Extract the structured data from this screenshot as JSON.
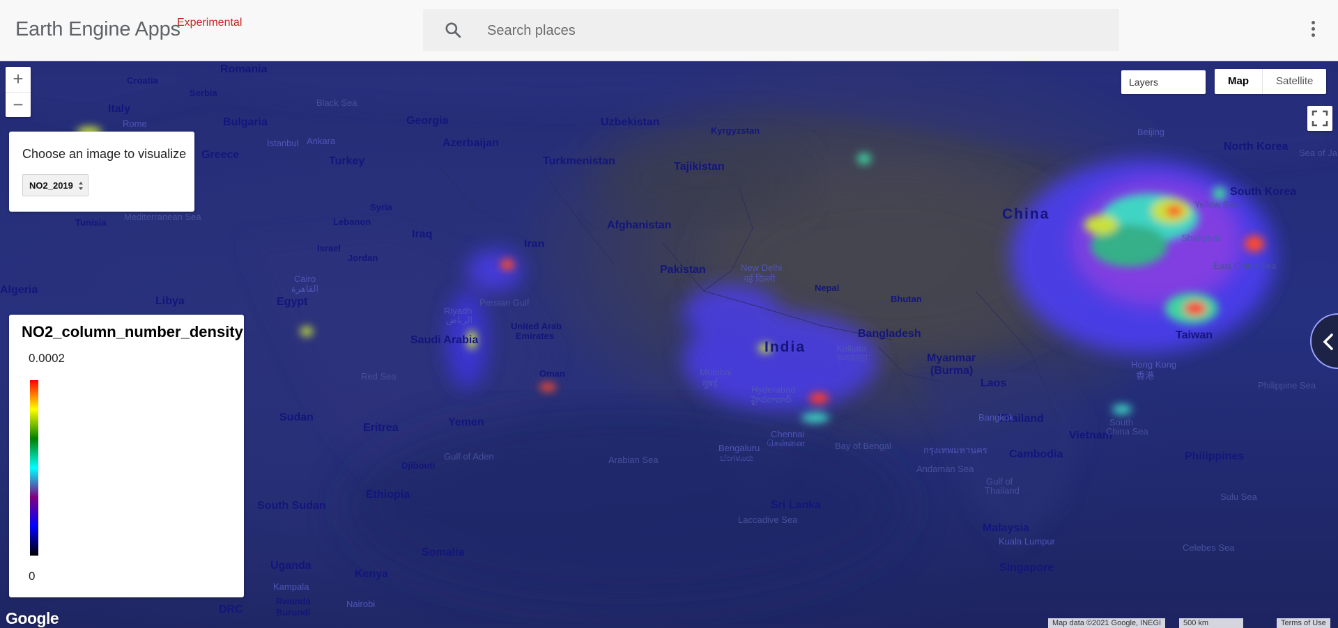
{
  "header": {
    "brand": "Earth Engine Apps",
    "brand_tag": "Experimental",
    "search_placeholder": "Search places"
  },
  "map_controls": {
    "zoom_in": "+",
    "zoom_out": "−",
    "layers_label": "Layers",
    "map_type": [
      "Map",
      "Satellite"
    ],
    "map_type_selected": "Map"
  },
  "panel": {
    "choose_label": "Choose an image to visualize",
    "selected_image": "NO2_2019"
  },
  "legend": {
    "title": "NO2_column_number_density",
    "max": "0.0002",
    "min": "0",
    "palette": [
      "#000000",
      "#0000ff",
      "#800080",
      "#00ffff",
      "#008000",
      "#ffff00",
      "#ff0000"
    ]
  },
  "map_labels": {
    "romania": "Romania",
    "croatia": "Croatia",
    "serbia": "Serbia",
    "italy": "Italy",
    "rome": "Rome",
    "bulgaria": "Bulgaria",
    "black_sea": "Black Sea",
    "georgia": "Georgia",
    "azerbaijan": "Azerbaijan",
    "uzbekistan": "Uzbekistan",
    "kyrgyzstan": "Kyrgyzstan",
    "turkmenistan": "Turkmenistan",
    "tajikistan": "Tajikistan",
    "greece": "Greece",
    "istanbul": "İstanbul",
    "ankara": "Ankara",
    "turkey": "Turkey",
    "syria": "Syria",
    "lebanon": "Lebanon",
    "israel": "Israel",
    "jordan": "Jordan",
    "iraq": "Iraq",
    "iran": "Iran",
    "afghanistan": "Afghanistan",
    "pakistan": "Pakistan",
    "tunisia": "Tunisia",
    "mediterranean": "Mediterranean Sea",
    "algeria": "Algeria",
    "libya": "Libya",
    "egypt": "Egypt",
    "cairo": "Cairo",
    "cairo_ar": "القاهرة",
    "saudi_arabia": "Saudi Arabia",
    "riyadh": "Riyadh",
    "riyadh_ar": "الرياض",
    "persian_gulf": "Persian Gulf",
    "uae": "United Arab",
    "uae2": "Emirates",
    "oman": "Oman",
    "red_sea": "Red Sea",
    "new_delhi": "New Delhi",
    "new_delhi_hi": "नई दिल्ली",
    "nepal": "Nepal",
    "bhutan": "Bhutan",
    "india": "India",
    "kolkata": "Kolkata",
    "kolkata_bn": "কলকাতা",
    "bangladesh": "Bangladesh",
    "mumbai": "Mumbai",
    "mumbai_mr": "मुंबई",
    "hyderabad": "Hyderabad",
    "hyderabad_te": "హైదరాబాద్",
    "chennai": "Chennai",
    "chennai_ta": "சென்னை",
    "bengaluru": "Bengaluru",
    "bengaluru_kn": "ಬೆಂಗಳೂರು",
    "sri_lanka": "Sri Lanka",
    "laccadive": "Laccadive Sea",
    "arabian_sea": "Arabian Sea",
    "bay_of_bengal": "Bay of Bengal",
    "andaman": "Andaman Sea",
    "sudan": "Sudan",
    "eritrea": "Eritrea",
    "yemen": "Yemen",
    "djibouti": "Djibouti",
    "gulf_of_aden": "Gulf of Aden",
    "ethiopia": "Ethiopia",
    "somalia": "Somalia",
    "south_sudan": "South Sudan",
    "uganda": "Uganda",
    "kampala": "Kampala",
    "kenya": "Kenya",
    "nairobi": "Nairobi",
    "rwanda": "Rwanda",
    "burundi": "Burundi",
    "drc": "DRC",
    "china": "China",
    "beijing": "Beijing",
    "north_korea": "North Korea",
    "south_korea": "South Korea",
    "sea_of_japan": "Sea of Ja",
    "yellow_sea": "Yellow Sea",
    "shanghai": "Shanghai",
    "east_china_sea": "East China Sea",
    "myanmar": "Myanmar",
    "burma": "(Burma)",
    "laos": "Laos",
    "taiwan": "Taiwan",
    "hong_kong": "Hong Kong",
    "hong_kong_zh": "香港",
    "philippine_sea": "Philippine Sea",
    "thailand": "Thailand",
    "bangkok": "Bangkok",
    "bangkok_th": "กรุงเทพมหานคร",
    "vietnam": "Vietnam",
    "south_china_sea": "South",
    "south_china_sea2": "China Sea",
    "cambodia": "Cambodia",
    "gulf_of_thailand": "Gulf of",
    "gulf_of_thailand2": "Thailand",
    "philippines": "Philippines",
    "sulu_sea": "Sulu Sea",
    "malaysia": "Malaysia",
    "kuala_lumpur": "Kuala Lumpur",
    "singapore": "Singapore",
    "celebes": "Celebes Sea"
  },
  "footer": {
    "google": "Google",
    "map_data": "Map data ©2021 Google, INEGI",
    "scale": "500 km",
    "terms": "Terms of Use"
  }
}
